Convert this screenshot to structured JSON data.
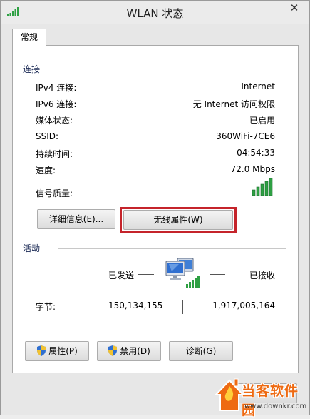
{
  "window": {
    "title": "WLAN 状态",
    "close_glyph": "✕"
  },
  "tabs": [
    {
      "label": "常规"
    }
  ],
  "connection": {
    "heading": "连接",
    "rows": [
      {
        "label": "IPv4 连接:",
        "value": "Internet"
      },
      {
        "label": "IPv6 连接:",
        "value": "无 Internet 访问权限"
      },
      {
        "label": "媒体状态:",
        "value": "已启用"
      },
      {
        "label": "SSID:",
        "value": "360WiFi-7CE6"
      },
      {
        "label": "持续时间:",
        "value": "04:54:33"
      },
      {
        "label": "速度:",
        "value": "72.0 Mbps"
      }
    ],
    "signal_label": "信号质量:",
    "signal_bars": 5,
    "details_button": "详细信息(E)...",
    "wireless_props_button": "无线属性(W)"
  },
  "activity": {
    "heading": "活动",
    "sent_label": "已发送",
    "received_label": "已接收",
    "bytes_label": "字节:",
    "bytes_sent": "150,134,155",
    "bytes_received": "1,917,005,164"
  },
  "bottom_buttons": {
    "properties": "属性(P)",
    "disable": "禁用(D)",
    "diagnose": "诊断(G)"
  },
  "watermark": {
    "brand": "当客软件园",
    "url": "www.downkr.com"
  },
  "colors": {
    "highlight": "#c5242b",
    "signal_green": "#2ea043",
    "watermark_orange": "#ee6a12"
  }
}
